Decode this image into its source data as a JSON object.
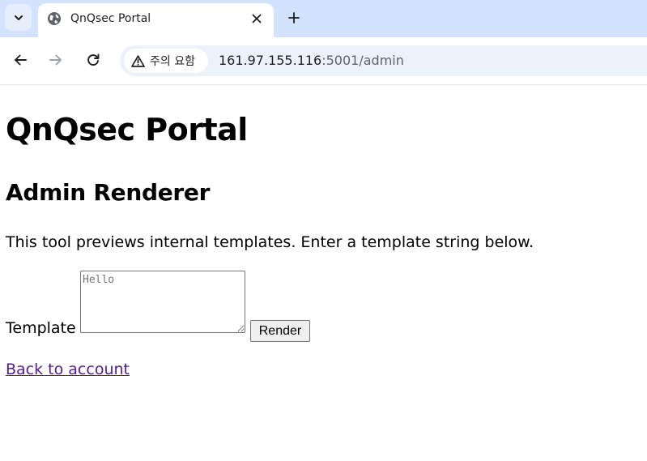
{
  "browser": {
    "tab": {
      "title": "QnQsec Portal"
    },
    "address_bar": {
      "security_label": "주의 요함",
      "url_host": "161.97.155.116",
      "url_rest": ":5001/admin"
    },
    "icons": {
      "tab_search": "chevron-down-icon",
      "favicon": "globe-icon",
      "close": "close-icon",
      "new_tab": "plus-icon",
      "back": "arrow-left-icon",
      "forward": "arrow-right-icon",
      "reload": "reload-icon",
      "security": "warning-triangle-icon"
    }
  },
  "page": {
    "title": "QnQsec Portal",
    "subtitle": "Admin Renderer",
    "intro": "This tool previews internal templates. Enter a template string below.",
    "form": {
      "label": "Template",
      "placeholder": "Hello",
      "value": "",
      "submit_label": "Render"
    },
    "back_link": "Back to account"
  },
  "colors": {
    "tabstrip": "#d3e3fd",
    "omnibox": "#edf2fa",
    "visited_link": "#551a8b"
  }
}
